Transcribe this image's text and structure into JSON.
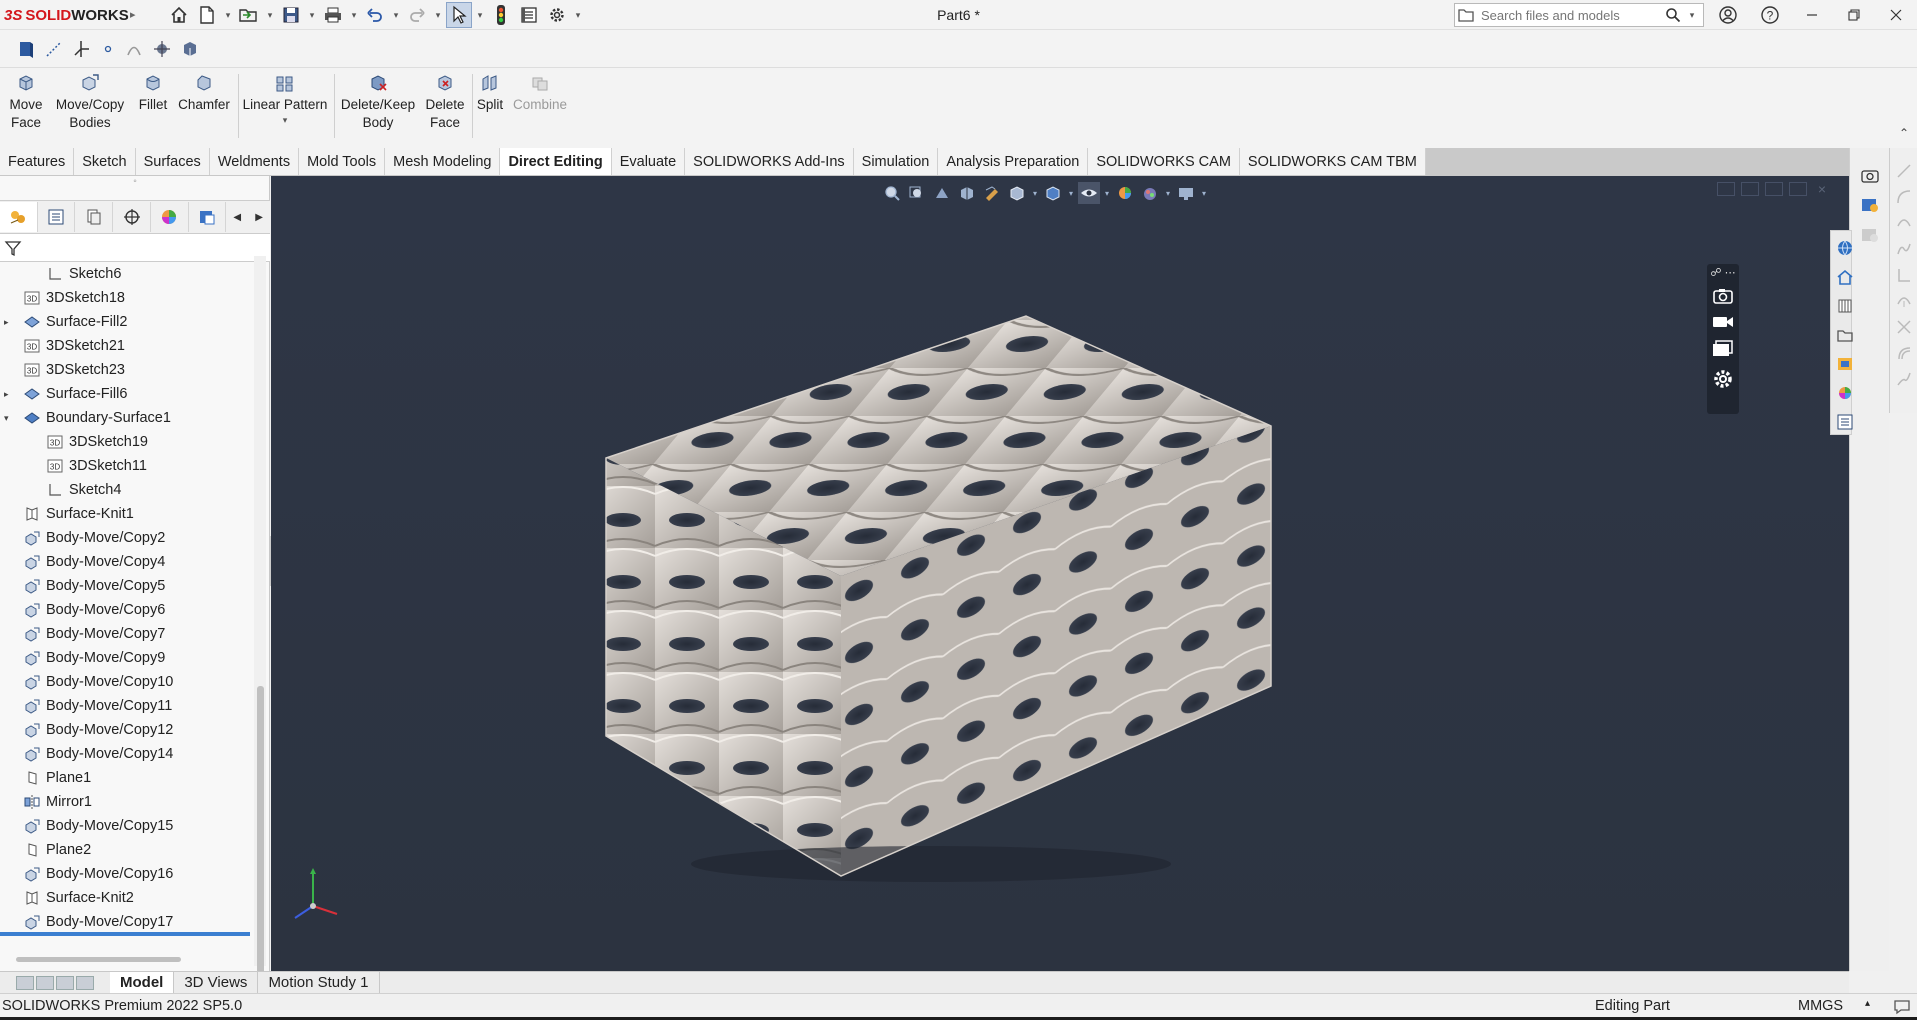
{
  "app": {
    "logo_prefix": "3S",
    "logo_a": "SOLID",
    "logo_b": "WORKS",
    "document_title": "Part6 *"
  },
  "search": {
    "placeholder": "Search files and models"
  },
  "command_manager": {
    "move_face": [
      "Move",
      "Face"
    ],
    "move_copy": [
      "Move/Copy",
      "Bodies"
    ],
    "fillet": "Fillet",
    "chamfer": "Chamfer",
    "linear_pattern": "Linear Pattern",
    "delete_keep": [
      "Delete/Keep",
      "Body"
    ],
    "delete_face": [
      "Delete",
      "Face"
    ],
    "split": "Split",
    "combine": "Combine"
  },
  "tabs": [
    {
      "label": "Features"
    },
    {
      "label": "Sketch"
    },
    {
      "label": "Surfaces"
    },
    {
      "label": "Weldments"
    },
    {
      "label": "Mold Tools"
    },
    {
      "label": "Mesh Modeling"
    },
    {
      "label": "Direct Editing",
      "active": true
    },
    {
      "label": "Evaluate"
    },
    {
      "label": "SOLIDWORKS Add-Ins"
    },
    {
      "label": "Simulation"
    },
    {
      "label": "Analysis Preparation"
    },
    {
      "label": "SOLIDWORKS CAM"
    },
    {
      "label": "SOLIDWORKS CAM TBM"
    }
  ],
  "tree": {
    "items": [
      {
        "label": "Sketch6",
        "type": "sketch",
        "level": 2
      },
      {
        "label": "3DSketch18",
        "type": "3dsketch",
        "level": 1
      },
      {
        "label": "Surface-Fill2",
        "type": "surface",
        "level": 1,
        "expand": "collapsed"
      },
      {
        "label": "3DSketch21",
        "type": "3dsketch",
        "level": 1
      },
      {
        "label": "3DSketch23",
        "type": "3dsketch",
        "level": 1
      },
      {
        "label": "Surface-Fill6",
        "type": "surface",
        "level": 1,
        "expand": "collapsed"
      },
      {
        "label": "Boundary-Surface1",
        "type": "surface",
        "level": 1,
        "expand": "expanded"
      },
      {
        "label": "3DSketch19",
        "type": "3dsketch",
        "level": 2
      },
      {
        "label": "3DSketch11",
        "type": "3dsketch",
        "level": 2
      },
      {
        "label": "Sketch4",
        "type": "sketch",
        "level": 2
      },
      {
        "label": "Surface-Knit1",
        "type": "knit",
        "level": 1
      },
      {
        "label": "Body-Move/Copy2",
        "type": "move",
        "level": 1
      },
      {
        "label": "Body-Move/Copy4",
        "type": "move",
        "level": 1
      },
      {
        "label": "Body-Move/Copy5",
        "type": "move",
        "level": 1
      },
      {
        "label": "Body-Move/Copy6",
        "type": "move",
        "level": 1
      },
      {
        "label": "Body-Move/Copy7",
        "type": "move",
        "level": 1
      },
      {
        "label": "Body-Move/Copy9",
        "type": "move",
        "level": 1
      },
      {
        "label": "Body-Move/Copy10",
        "type": "move",
        "level": 1
      },
      {
        "label": "Body-Move/Copy11",
        "type": "move",
        "level": 1
      },
      {
        "label": "Body-Move/Copy12",
        "type": "move",
        "level": 1
      },
      {
        "label": "Body-Move/Copy14",
        "type": "move",
        "level": 1
      },
      {
        "label": "Plane1",
        "type": "plane",
        "level": 1
      },
      {
        "label": "Mirror1",
        "type": "mirror",
        "level": 1
      },
      {
        "label": "Body-Move/Copy15",
        "type": "move",
        "level": 1
      },
      {
        "label": "Plane2",
        "type": "plane",
        "level": 1
      },
      {
        "label": "Body-Move/Copy16",
        "type": "move",
        "level": 1
      },
      {
        "label": "Surface-Knit2",
        "type": "knit",
        "level": 1
      },
      {
        "label": "Body-Move/Copy17",
        "type": "move",
        "level": 1
      }
    ]
  },
  "bottom_tabs": [
    {
      "label": "Model",
      "active": true
    },
    {
      "label": "3D Views"
    },
    {
      "label": "Motion Study 1"
    }
  ],
  "status": {
    "product": "SOLIDWORKS Premium 2022 SP5.0",
    "mode": "Editing Part",
    "units": "MMGS"
  },
  "colors": {
    "viewport_bg": "#2d3443",
    "model_surface": "#cfc9c3",
    "accent_blue": "#3b7fd1",
    "logo_red": "#d4161c"
  }
}
